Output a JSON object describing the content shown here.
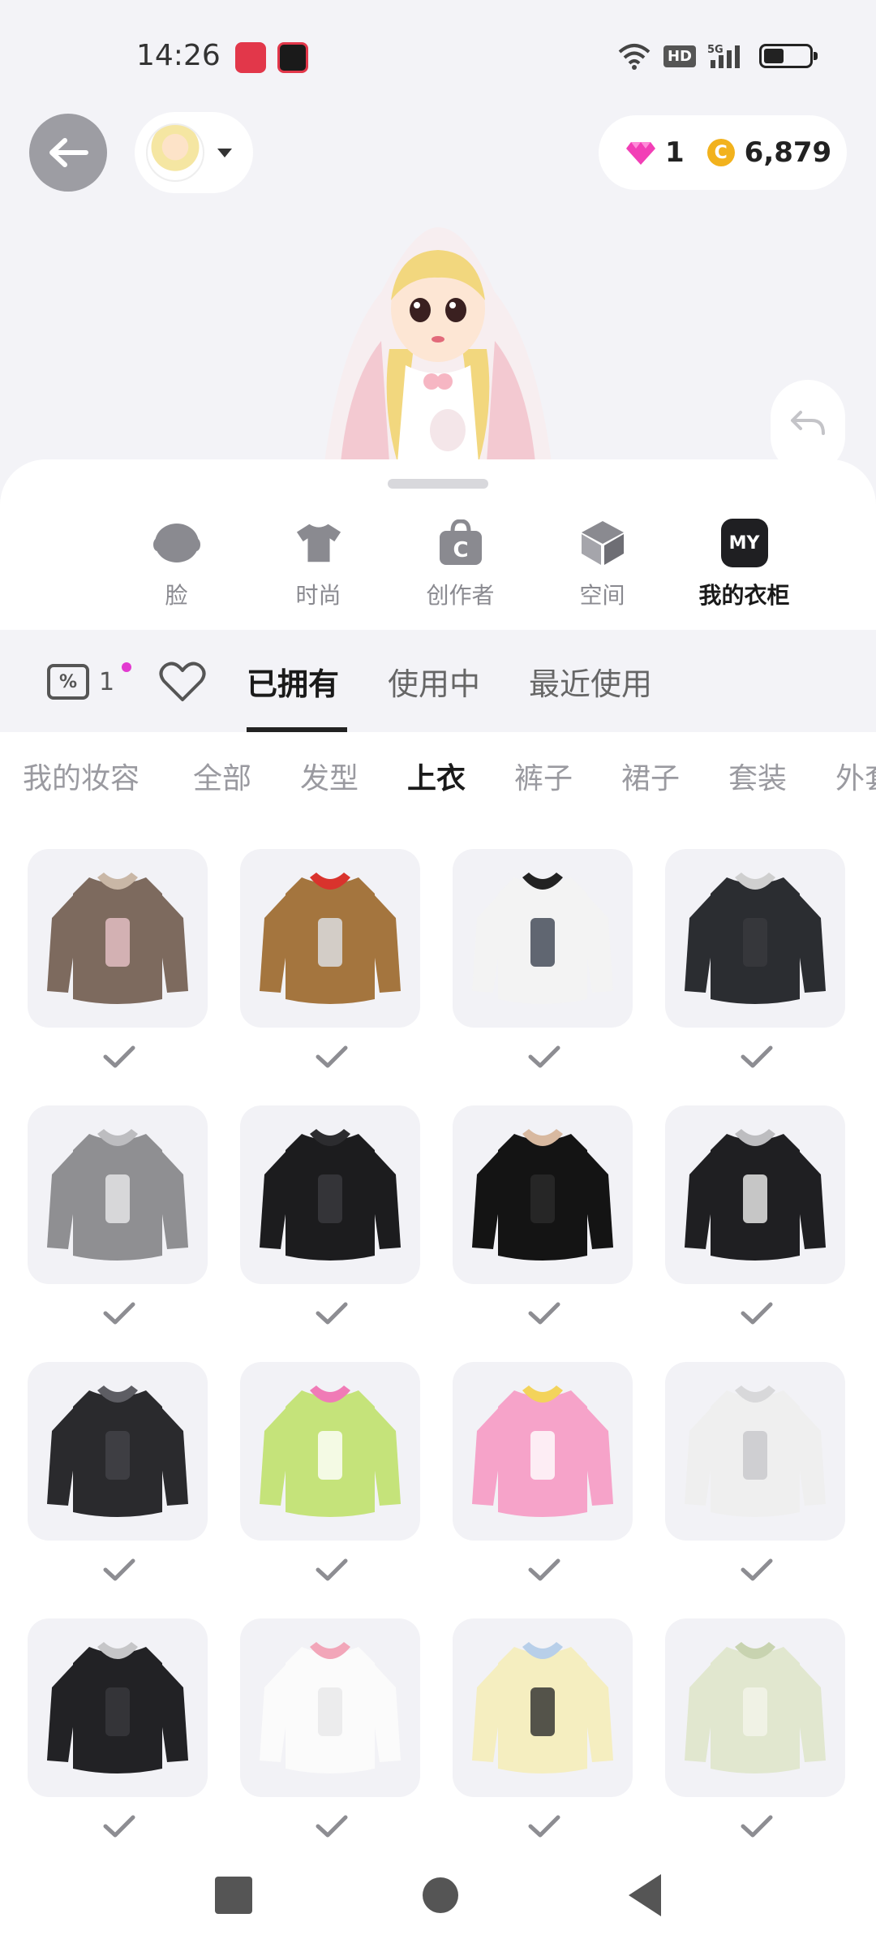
{
  "status_bar": {
    "time": "14:26",
    "hd_badge": "HD",
    "network": "5G",
    "battery_level": 0.45,
    "icons": [
      "screen-record-icon",
      "video-app-icon",
      "wifi-icon",
      "signal-icon",
      "battery-icon"
    ]
  },
  "header": {
    "back_icon": "arrow-left-icon",
    "avatar_caret_icon": "caret-down-icon",
    "gem_count": "1",
    "coin_symbol": "C",
    "coin_count": "6,879",
    "undo_icon": "undo-icon"
  },
  "category_tabs": [
    {
      "label": "脸",
      "icon": "face-icon"
    },
    {
      "label": "时尚",
      "icon": "tshirt-icon"
    },
    {
      "label": "创作者",
      "icon": "creator-bag-icon"
    },
    {
      "label": "空间",
      "icon": "cube-icon"
    },
    {
      "label": "我的衣柜",
      "icon": "my-wardrobe-icon",
      "icon_text": "MY",
      "active": true
    }
  ],
  "filter_bar": {
    "coupon_count": "1",
    "coupon_symbol": "%",
    "heart_icon": "heart-icon",
    "tabs": [
      {
        "label": "已拥有",
        "active": true
      },
      {
        "label": "使用中"
      },
      {
        "label": "最近使用"
      }
    ]
  },
  "type_tabs": [
    {
      "label": "我的妆容"
    },
    {
      "label": "全部"
    },
    {
      "label": "发型"
    },
    {
      "label": "上衣",
      "active": true
    },
    {
      "label": "裤子"
    },
    {
      "label": "裙子"
    },
    {
      "label": "套装"
    },
    {
      "label": "外套"
    }
  ],
  "items": [
    {
      "name": "leopard-fur-cropped-jacket",
      "colors": [
        "#7d6a5e",
        "#c9b7a6",
        "#e9c3c8"
      ],
      "owned": true
    },
    {
      "name": "leopard-vest-red-scarf",
      "colors": [
        "#a4753e",
        "#d9332d",
        "#dfe3ea"
      ],
      "owned": true
    },
    {
      "name": "white-track-jacket",
      "colors": [
        "#f3f3f3",
        "#222222",
        "#3b4250"
      ],
      "owned": true
    },
    {
      "name": "black-denim-jacket",
      "colors": [
        "#2b2d31",
        "#cfcfcf",
        "#3a3a3e"
      ],
      "owned": true
    },
    {
      "name": "grey-zip-hoodie",
      "colors": [
        "#8f8f92",
        "#bdbdc0",
        "#e9e9eb"
      ],
      "owned": true
    },
    {
      "name": "black-turtleneck",
      "colors": [
        "#1c1c1e",
        "#2c2c2f",
        "#3b3b3e"
      ],
      "owned": true
    },
    {
      "name": "black-tshirt",
      "colors": [
        "#141414",
        "#d8b9a0",
        "#2b2b2b"
      ],
      "owned": true
    },
    {
      "name": "black-hoodie-jacket",
      "colors": [
        "#1f1f22",
        "#bdbdc0",
        "#f0f0f0"
      ],
      "owned": true
    },
    {
      "name": "grey-star-tee",
      "colors": [
        "#2a2a2d",
        "#5d5d63",
        "#444449"
      ],
      "owned": true
    },
    {
      "name": "green-anime-print-top",
      "colors": [
        "#c5e37a",
        "#f07bb6",
        "#ffffff"
      ],
      "owned": true
    },
    {
      "name": "pink-anime-print-top",
      "colors": [
        "#f6a3c9",
        "#f3d35b",
        "#ffffff"
      ],
      "owned": true
    },
    {
      "name": "white-off-shoulder-knit",
      "colors": [
        "#efefef",
        "#d8d8da",
        "#c7c7ca"
      ],
      "owned": true
    },
    {
      "name": "black-fitted-long-sleeve",
      "colors": [
        "#222225",
        "#c6c6c8",
        "#3a3a3d"
      ],
      "owned": true
    },
    {
      "name": "white-ribbon-tee",
      "colors": [
        "#fbfbfb",
        "#f2a6b9",
        "#e9e9ea"
      ],
      "owned": true
    },
    {
      "name": "pastel-yellow-panda-jacket",
      "colors": [
        "#f5eec0",
        "#b8cfe9",
        "#2c2c2c"
      ],
      "owned": true
    },
    {
      "name": "sage-ruffle-dress-top",
      "colors": [
        "#e1e7cf",
        "#c8d3b0",
        "#f4f5ea"
      ],
      "owned": true
    }
  ],
  "nav": {
    "icons": [
      "recents-square-icon",
      "home-circle-icon",
      "back-triangle-icon"
    ]
  }
}
